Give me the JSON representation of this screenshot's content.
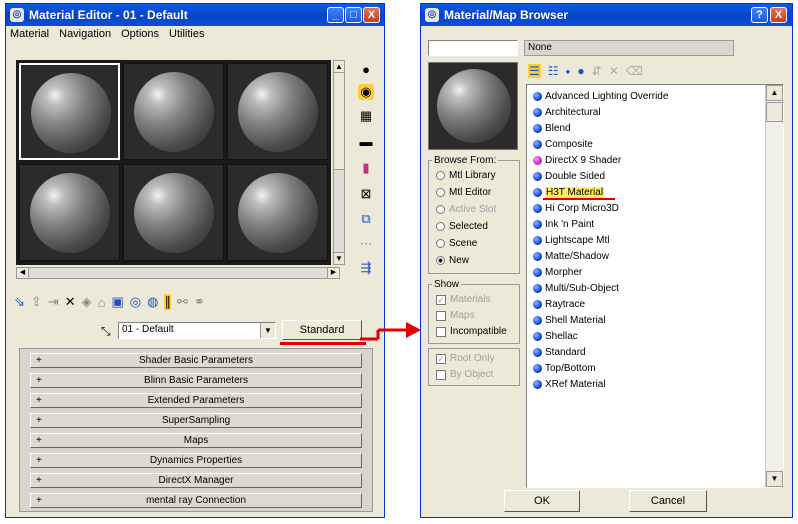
{
  "material_editor": {
    "title": "Material Editor - 01 - Default",
    "menu": [
      "Material",
      "Navigation",
      "Options",
      "Utilities"
    ],
    "window_buttons": {
      "minimize": "_",
      "maximize": "□",
      "close": "X"
    },
    "material_name": "01 - Default",
    "type_button": "Standard",
    "rollouts": [
      "Shader Basic Parameters",
      "Blinn Basic Parameters",
      "Extended Parameters",
      "SuperSampling",
      "Maps",
      "Dynamics Properties",
      "DirectX Manager",
      "mental ray Connection"
    ],
    "rollout_toggle": "+"
  },
  "map_browser": {
    "title": "Material/Map Browser",
    "window_buttons": {
      "help": "?",
      "close": "X"
    },
    "name_field": "None",
    "browse_from_label": "Browse From:",
    "browse_from": [
      {
        "label": "Mtl Library",
        "selected": false,
        "enabled": true
      },
      {
        "label": "Mtl Editor",
        "selected": false,
        "enabled": true
      },
      {
        "label": "Active Slot",
        "selected": false,
        "enabled": false
      },
      {
        "label": "Selected",
        "selected": false,
        "enabled": true
      },
      {
        "label": "Scene",
        "selected": false,
        "enabled": true
      },
      {
        "label": "New",
        "selected": true,
        "enabled": true
      }
    ],
    "show_label": "Show",
    "show": [
      {
        "label": "Materials",
        "checked": true,
        "enabled": false
      },
      {
        "label": "Maps",
        "checked": false,
        "enabled": false
      },
      {
        "label": "Incompatible",
        "checked": false,
        "enabled": true
      }
    ],
    "root_options": [
      {
        "label": "Root Only",
        "checked": true,
        "enabled": false
      },
      {
        "label": "By Object",
        "checked": false,
        "enabled": false
      }
    ],
    "items": [
      "Advanced Lighting Override",
      "Architectural",
      "Blend",
      "Composite",
      "DirectX 9 Shader",
      "Double Sided",
      "H3T Material",
      "Hi Corp Micro3D",
      "Ink 'n Paint",
      "Lightscape Mtl",
      "Matte/Shadow",
      "Morpher",
      "Multi/Sub-Object",
      "Raytrace",
      "Shell Material",
      "Shellac",
      "Standard",
      "Top/Bottom",
      "XRef Material"
    ],
    "highlighted_item": "H3T Material",
    "ok_label": "OK",
    "cancel_label": "Cancel"
  },
  "colors": {
    "annotation_red": "#e00000",
    "highlight_yellow": "#ffee55",
    "title_blue": "#0842c8"
  }
}
